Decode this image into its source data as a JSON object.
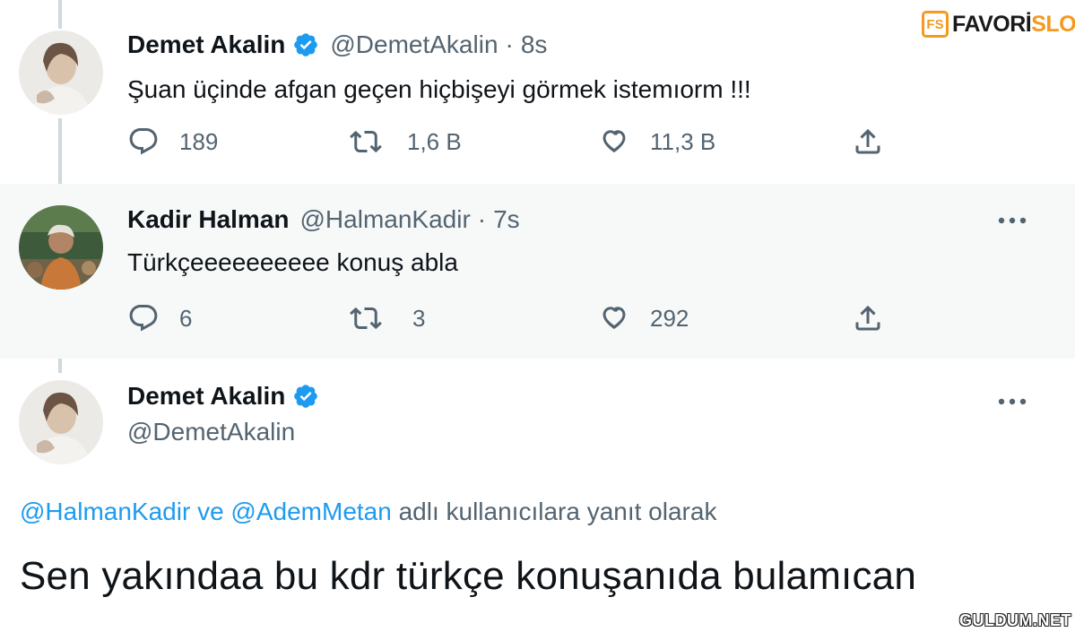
{
  "logo": {
    "icon_text": "FS",
    "word1": "FAVORİ",
    "word2": "SLOT",
    "accent": "#f39a1f"
  },
  "tweets": [
    {
      "name": "Demet Akalin",
      "verified": true,
      "handle": "@DemetAkalin",
      "separator": "·",
      "time": "8s",
      "text": "Şuan üçinde afgan geçen hiçbişeyi görmek istemıorm !!!",
      "actions": {
        "reply_count": "189",
        "retweet_count": "1,6 B",
        "like_count": "11,3 B"
      }
    },
    {
      "name": "Kadir Halman",
      "verified": false,
      "handle": "@HalmanKadir",
      "separator": "·",
      "time": "7s",
      "text": "Türkçeeeeeeeeee konuş abla",
      "actions": {
        "reply_count": "6",
        "retweet_count": "3",
        "like_count": "292"
      }
    }
  ],
  "main_tweet": {
    "name": "Demet Akalin",
    "verified": true,
    "handle": "@DemetAkalin",
    "reply_to": {
      "mention1": "@HalmanKadir",
      "conjunction": "ve",
      "mention2": "@AdemMetan",
      "suffix": "adlı kullanıcılara yanıt olarak"
    },
    "text": "Sen yakındaa bu kdr türkçe konuşanıda bulamıcan"
  },
  "watermark": "GULDUM.NET",
  "colors": {
    "verified_blue": "#1d9bf0",
    "secondary_text": "#536471",
    "highlight_bg": "#f7f9f9",
    "thread_line": "#cfd9de"
  }
}
